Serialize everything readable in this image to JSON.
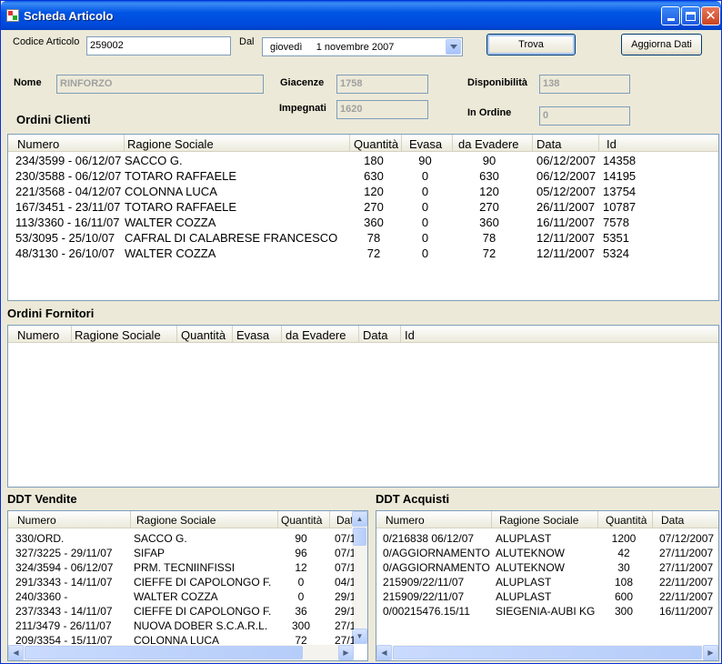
{
  "window": {
    "title": "Scheda Articolo"
  },
  "search": {
    "codice_label": "Codice Articolo",
    "codice_value": "259002",
    "dal_label": "Dal",
    "date_value": "giovedì     1 novembre 2007",
    "trova_label": "Trova",
    "aggiorna_label": "Aggiorna Dati"
  },
  "info": {
    "nome_label": "Nome",
    "nome_value": "RINFORZO",
    "giacenze_label": "Giacenze",
    "giacenze_value": "1758",
    "impegnati_label": "Impegnati",
    "impegnati_value": "1620",
    "disponibilita_label": "Disponibilità",
    "disponibilita_value": "138",
    "in_ordine_label": "In Ordine",
    "in_ordine_value": "0"
  },
  "ordini_clienti": {
    "title": "Ordini Clienti",
    "columns": [
      "Numero",
      "Ragione Sociale",
      "Quantità",
      "Evasa",
      "da Evadere",
      "Data",
      "Id"
    ],
    "rows": [
      [
        "234/3599 - 06/12/07",
        "SACCO G.",
        "180",
        "90",
        "90",
        "06/12/2007",
        "14358"
      ],
      [
        "230/3588 - 06/12/07",
        "TOTARO RAFFAELE",
        "630",
        "0",
        "630",
        "06/12/2007",
        "14195"
      ],
      [
        "221/3568 - 04/12/07",
        "COLONNA LUCA",
        "120",
        "0",
        "120",
        "05/12/2007",
        "13754"
      ],
      [
        "167/3451 - 23/11/07",
        "TOTARO RAFFAELE",
        "270",
        "0",
        "270",
        "26/11/2007",
        "10787"
      ],
      [
        "113/3360 - 16/11/07",
        "WALTER COZZA",
        "360",
        "0",
        "360",
        "16/11/2007",
        "7578"
      ],
      [
        "53/3095 - 25/10/07",
        "CAFRAL DI CALABRESE FRANCESCO",
        "78",
        "0",
        "78",
        "12/11/2007",
        "5351"
      ],
      [
        "48/3130 - 26/10/07",
        "WALTER COZZA",
        "72",
        "0",
        "72",
        "12/11/2007",
        "5324"
      ]
    ]
  },
  "ordini_fornitori": {
    "title": "Ordini Fornitori",
    "columns": [
      "Numero",
      "Ragione Sociale",
      "Quantità",
      "Evasa",
      "da Evadere",
      "Data",
      "Id"
    ]
  },
  "ddt_vendite": {
    "title": "DDT Vendite",
    "columns": [
      "Numero",
      "Ragione Sociale",
      "Quantità",
      "Dat"
    ],
    "rows": [
      [
        "330/ORD.",
        "SACCO G.",
        "90",
        "07/1"
      ],
      [
        "327/3225 - 29/11/07",
        "SIFAP",
        "96",
        "07/1"
      ],
      [
        "324/3594 - 06/12/07",
        "PRM. TECNIINFISSI",
        "12",
        "07/1"
      ],
      [
        "291/3343 - 14/11/07",
        "CIEFFE DI CAPOLONGO F.",
        "0",
        "04/1"
      ],
      [
        "240/3360 -",
        "WALTER COZZA",
        "0",
        "29/1"
      ],
      [
        "237/3343 - 14/11/07",
        "CIEFFE DI CAPOLONGO F.",
        "36",
        "29/1"
      ],
      [
        "211/3479 - 26/11/07",
        "NUOVA DOBER S.C.A.R.L.",
        "300",
        "27/1"
      ],
      [
        "209/3354 - 15/11/07",
        "COLONNA LUCA",
        "72",
        "27/1"
      ]
    ]
  },
  "ddt_acquisti": {
    "title": "DDT Acquisti",
    "columns": [
      "Numero",
      "Ragione Sociale",
      "Quantità",
      "Data"
    ],
    "rows": [
      [
        "0/216838 06/12/07",
        "ALUPLAST",
        "1200",
        "07/12/2007"
      ],
      [
        "0/AGGIORNAMENTO",
        "ALUTEKNOW",
        "42",
        "27/11/2007"
      ],
      [
        "0/AGGIORNAMENTO",
        "ALUTEKNOW",
        "30",
        "27/11/2007"
      ],
      [
        "215909/22/11/07",
        "ALUPLAST",
        "108",
        "22/11/2007"
      ],
      [
        "215909/22/11/07",
        "ALUPLAST",
        "600",
        "22/11/2007"
      ],
      [
        "0/00215476.15/11",
        "SIEGENIA-AUBI KG",
        "300",
        "16/11/2007"
      ]
    ]
  }
}
